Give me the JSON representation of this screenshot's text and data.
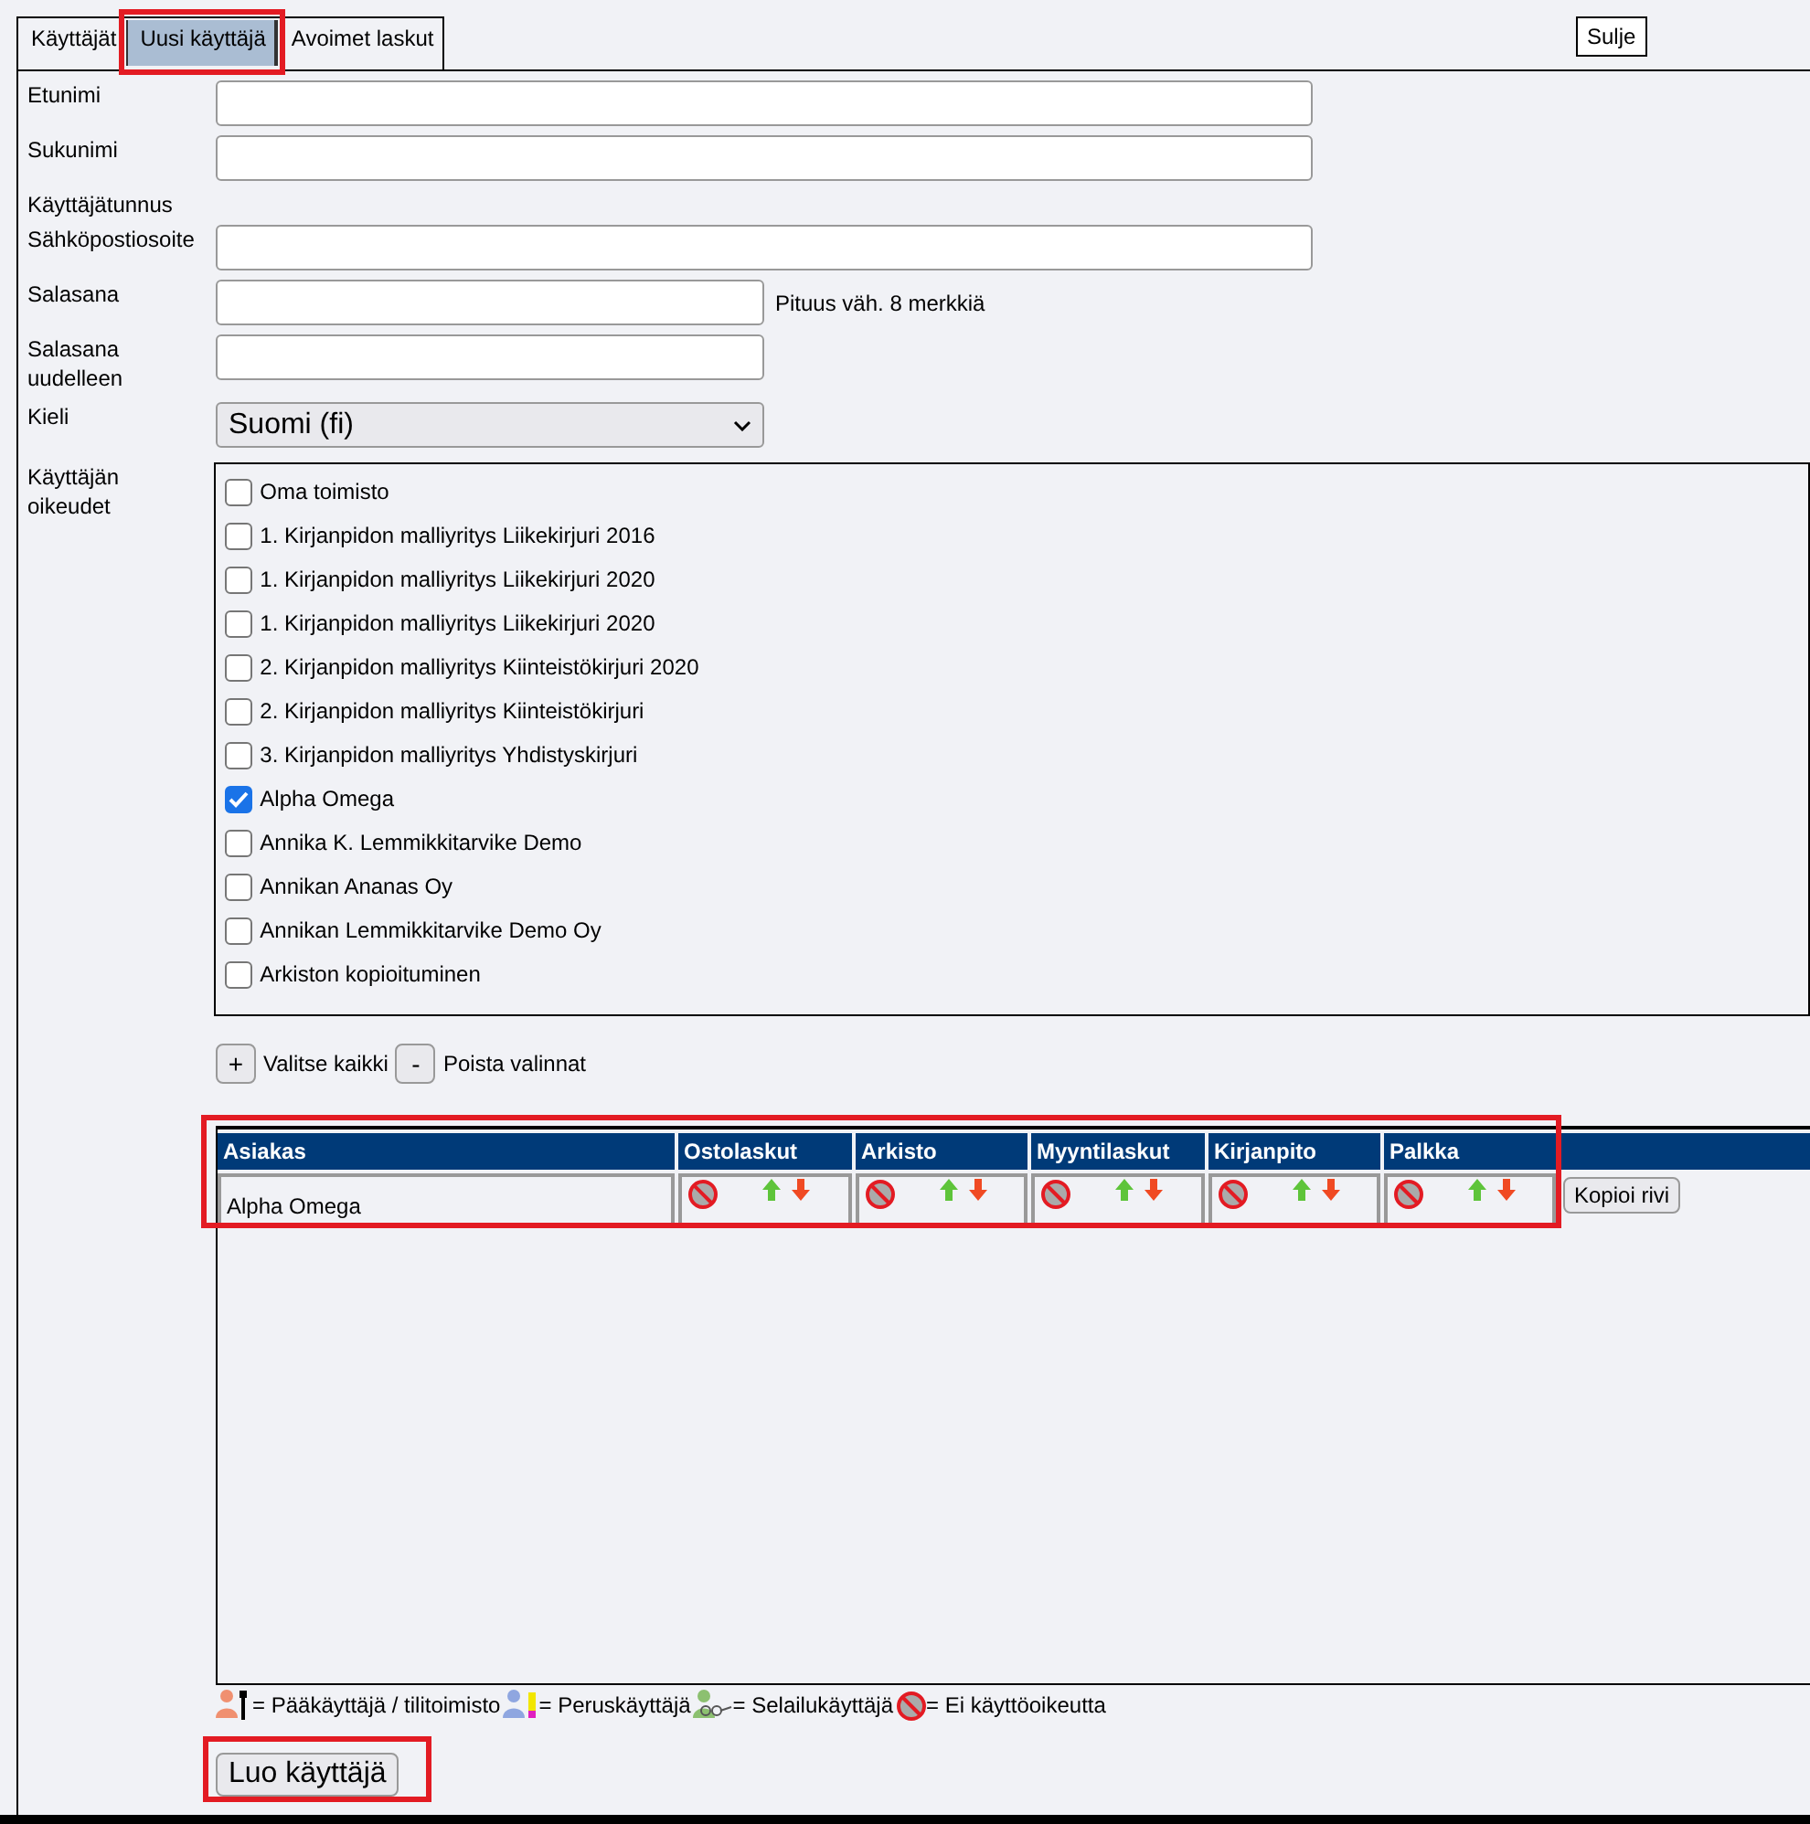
{
  "tabs": [
    {
      "label": "Käyttäjät",
      "selected": false
    },
    {
      "label": "Uusi käyttäjä",
      "selected": true,
      "highlighted": true
    },
    {
      "label": "Avoimet laskut",
      "selected": false
    }
  ],
  "close_button": "Sulje",
  "form": [
    {
      "kind": "text",
      "label": "Etunimi"
    },
    {
      "kind": "text",
      "label": "Sukunimi"
    },
    {
      "kind": "label",
      "label": "Käyttäjätunnus"
    },
    {
      "kind": "text",
      "label": "Sähköpostiosoite"
    },
    {
      "kind": "password",
      "label": "Salasana",
      "hint": "Pituus väh. 8 merkkiä"
    },
    {
      "kind": "password",
      "label": "Salasana uudelleen"
    },
    {
      "kind": "select",
      "label": "Kieli",
      "value": "Suomi (fi)"
    }
  ],
  "rights_label": "Käyttäjän oikeudet",
  "clients": [
    {
      "name": "Oma toimisto",
      "checked": false
    },
    {
      "name": "1. Kirjanpidon malliyritys Liikekirjuri 2016",
      "checked": false
    },
    {
      "name": "1. Kirjanpidon malliyritys Liikekirjuri 2020",
      "checked": false
    },
    {
      "name": "1. Kirjanpidon malliyritys Liikekirjuri 2020",
      "checked": false
    },
    {
      "name": "2. Kirjanpidon malliyritys Kiinteistökirjuri 2020",
      "checked": false
    },
    {
      "name": "2. Kirjanpidon malliyritys Kiinteistökirjuri",
      "checked": false
    },
    {
      "name": "3. Kirjanpidon malliyritys Yhdistyskirjuri",
      "checked": false
    },
    {
      "name": "Alpha Omega",
      "checked": true
    },
    {
      "name": "Annika K. Lemmikkitarvike Demo",
      "checked": false
    },
    {
      "name": "Annikan Ananas Oy",
      "checked": false
    },
    {
      "name": "Annikan Lemmikkitarvike Demo Oy",
      "checked": false
    },
    {
      "name": "Arkiston kopioituminen",
      "checked": false
    }
  ],
  "select_all": {
    "button": "+",
    "label": "Valitse kaikki"
  },
  "clear_all": {
    "button": "-",
    "label": "Poista valinnat"
  },
  "rights_table": {
    "highlighted": true,
    "columns": [
      "Asiakas",
      "Ostolaskut",
      "Arkisto",
      "Myyntilaskut",
      "Kirjanpito",
      "Palkka"
    ],
    "rows": [
      {
        "client": "Alpha Omega",
        "cells": [
          {
            "kind": "no_access"
          },
          {
            "kind": "no_access"
          },
          {
            "kind": "no_access"
          },
          {
            "kind": "no_access"
          },
          {
            "kind": "no_access"
          }
        ],
        "copy_button": "Kopioi rivi"
      }
    ]
  },
  "legend": [
    {
      "kind": "admin",
      "label": "= Pääkäyttäjä / tilitoimisto"
    },
    {
      "kind": "basic",
      "label": "= Peruskäyttäjä"
    },
    {
      "kind": "viewer",
      "label": "= Selailukäyttäjä"
    },
    {
      "kind": "none",
      "label": "= Ei käyttöoikeutta"
    }
  ],
  "submit": {
    "label": "Luo käyttäjä",
    "highlighted": true
  }
}
